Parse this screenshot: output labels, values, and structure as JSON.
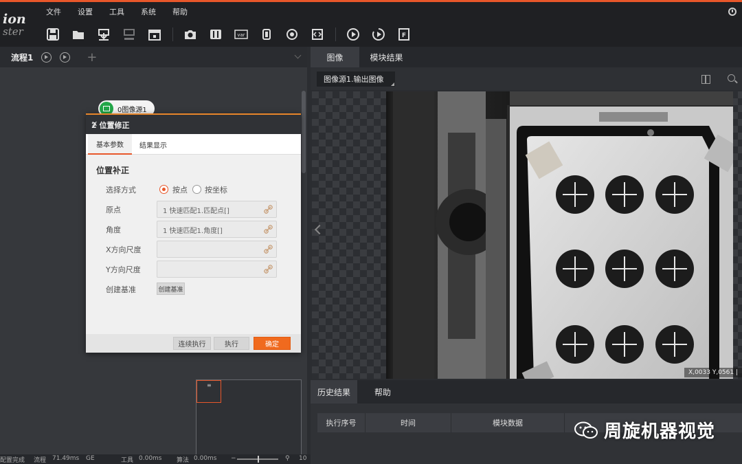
{
  "app": {
    "logo_line1": "ion",
    "logo_line2": "ster"
  },
  "menu": [
    "文件",
    "设置",
    "工具",
    "系统",
    "帮助"
  ],
  "toolbar": {
    "items": [
      "save-icon",
      "open-folder-icon",
      "import-icon",
      "export-icon",
      "calendar-icon",
      "camera-icon",
      "controller-icon",
      "variable-icon",
      "device-icon",
      "communication-icon",
      "script-icon",
      "run-once-icon",
      "run-loop-icon",
      "format-icon"
    ],
    "var_label": "var",
    "f_label": "F"
  },
  "flow": {
    "tab_label": "流程1",
    "add_label": "+",
    "node_label": "0图像源1"
  },
  "dialog": {
    "title": "2 位置修正",
    "tabs": [
      "基本参数",
      "结果显示"
    ],
    "section_title": "位置补正",
    "select_mode_label": "选择方式",
    "radio_point": "按点",
    "radio_coord": "按坐标",
    "origin_label": "原点",
    "origin_value": "1 快速匹配1.匹配点[]",
    "angle_label": "角度",
    "angle_value": "1 快速匹配1.角度[]",
    "x_scale_label": "X方向尺度",
    "y_scale_label": "Y方向尺度",
    "create_base_label": "创建基准",
    "create_base_button": "创建基准",
    "btn_continuous": "连续执行",
    "btn_execute": "执行",
    "btn_confirm": "确定",
    "close": "✕"
  },
  "minimap": {
    "marker": "≡",
    "resize": "↘"
  },
  "image_panel": {
    "tabs": [
      "图像",
      "模块结果"
    ],
    "source_select": "图像源1.输出图像",
    "coord_readout": "X,0033   Y,0561  |"
  },
  "history": {
    "tabs": [
      "历史结果",
      "帮助"
    ],
    "columns": [
      "执行序号",
      "时间",
      "模块数据"
    ]
  },
  "watermark": {
    "text": "周旋机器视觉"
  },
  "status_bar": {
    "config_status": "配置完成",
    "flow_label": "流程",
    "flow_time": "71.49ms",
    "ge": "GE",
    "tool_label": "工具",
    "tool_time": "0.00ms",
    "algo_label": "算法",
    "algo_time": "0.00ms",
    "zoom_minus": "−",
    "zoom_plus": "10"
  },
  "colors": {
    "accent": "#e8572a",
    "confirm": "#f06a1e",
    "node_green": "#22a648"
  }
}
